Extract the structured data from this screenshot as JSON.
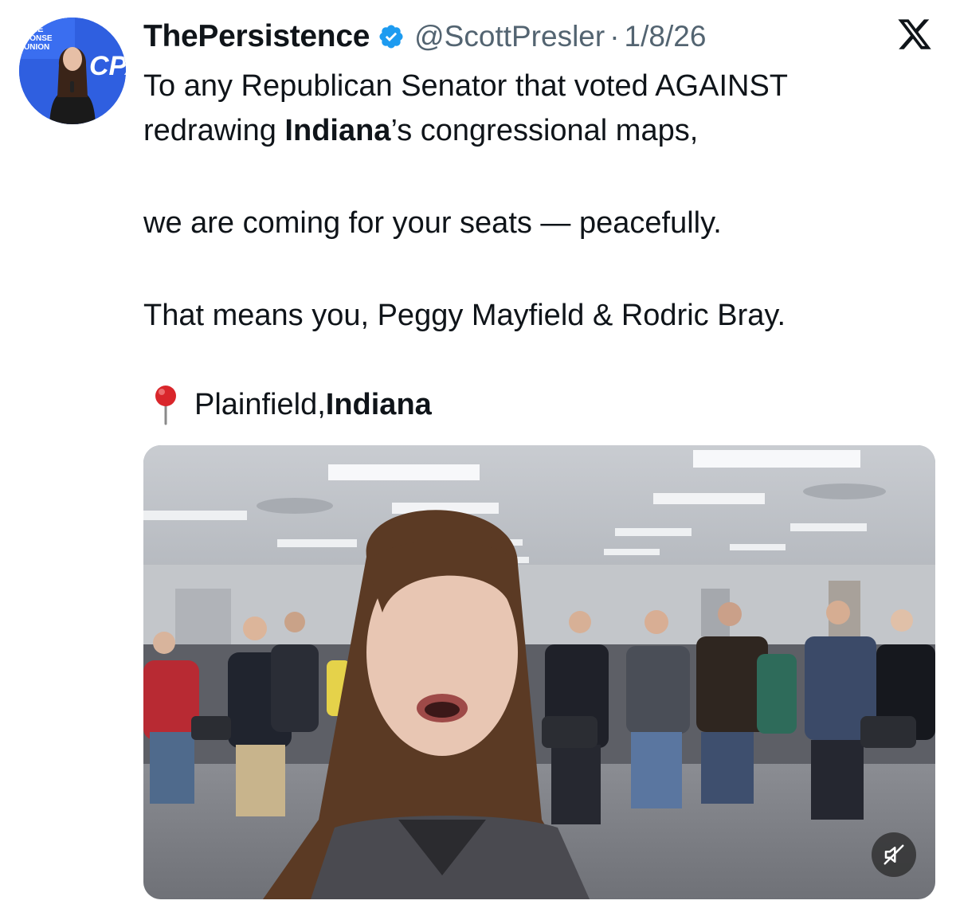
{
  "tweet": {
    "display_name": "ThePersistence",
    "handle": "@ScottPresler",
    "separator": "·",
    "date": "1/8/26",
    "body": {
      "line1_pre": "To any Republican Senator that voted AGAINST",
      "line2_pre": "redrawing ",
      "line2_bold": "Indiana",
      "line2_post": "’s congressional maps,",
      "line3": "we are coming for your seats — peacefully.",
      "line4": "That means you, Peggy Mayfield & Rodric Bray."
    },
    "location": {
      "pin_icon": "round-pushpin-icon",
      "city": "Plainfield, ",
      "state": "Indiana"
    },
    "avatar": {
      "banner_text_1": "AME",
      "banner_text_2": "CONSE",
      "banner_text_3": "UNION",
      "logo_text": "CPA"
    },
    "media": {
      "type": "video",
      "mute_icon": "speaker-muted-icon"
    }
  },
  "icons": {
    "verified": "verified-badge-icon",
    "platform": "x-logo-icon"
  },
  "colors": {
    "text": "#0f1419",
    "secondary": "#536471",
    "verified_blue": "#1d9bf0",
    "avatar_bg": "#2d5bd8"
  }
}
